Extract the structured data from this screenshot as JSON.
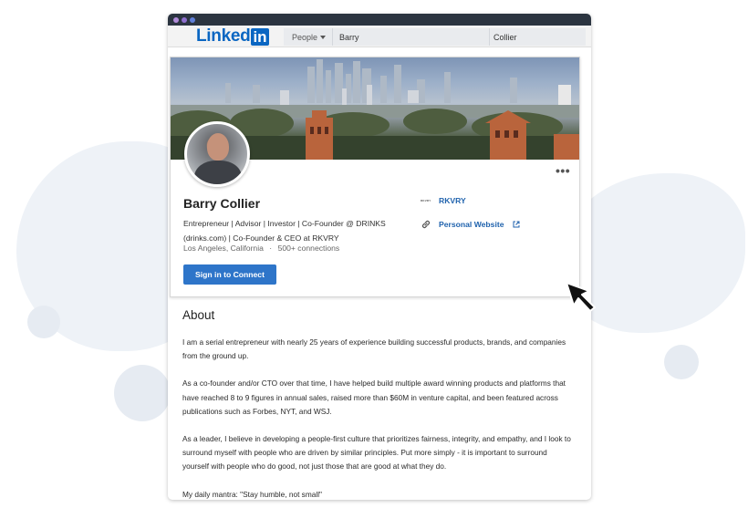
{
  "search": {
    "type": "People",
    "first_name": "Barry",
    "last_name": "Collier"
  },
  "logo": {
    "text": "Linked",
    "box": "in"
  },
  "profile": {
    "name": "Barry Collier",
    "headline_line1": "Entrepreneur | Advisor | Investor | Co-Founder @ DRINKS",
    "headline_line2": "(drinks.com) | Co-Founder & CEO at RKVRY",
    "location": "Los Angeles, California",
    "separator": "·",
    "connections": "500+ connections",
    "connect_button": "Sign in to Connect",
    "more_actions": "•••",
    "company_logo_text": "RKVRY",
    "company": "RKVRY",
    "website": "Personal Website"
  },
  "about": {
    "title": "About",
    "paragraphs": [
      "I am a serial entrepreneur with nearly 25 years of experience building successful products, brands, and companies from the ground up.",
      "As a co-founder and/or CTO over that time, I have helped build multiple award winning products and platforms that have reached 8 to 9 figures in annual sales, raised more than $60M in venture capital, and been featured across publications such as Forbes, NYT, and WSJ.",
      "As a leader, I believe in developing a people-first culture that prioritizes fairness, integrity, and empathy, and I look to surround myself with people who are driven by similar principles. Put more simply - it is important to surround yourself with people who do good, not just those that are good at what they do.",
      "My daily mantra: \"Stay humble, not small\""
    ]
  },
  "icons": [
    "more-icon",
    "company-logo-icon",
    "link-icon",
    "external-link-icon",
    "cursor-icon",
    "caret-down-icon"
  ],
  "colors": {
    "brand": "#0a66c2",
    "button": "#2e75c9",
    "link": "#1f62ad",
    "window_buttons": [
      "#b18bd9",
      "#8f6fcf",
      "#5f7fd9"
    ]
  }
}
